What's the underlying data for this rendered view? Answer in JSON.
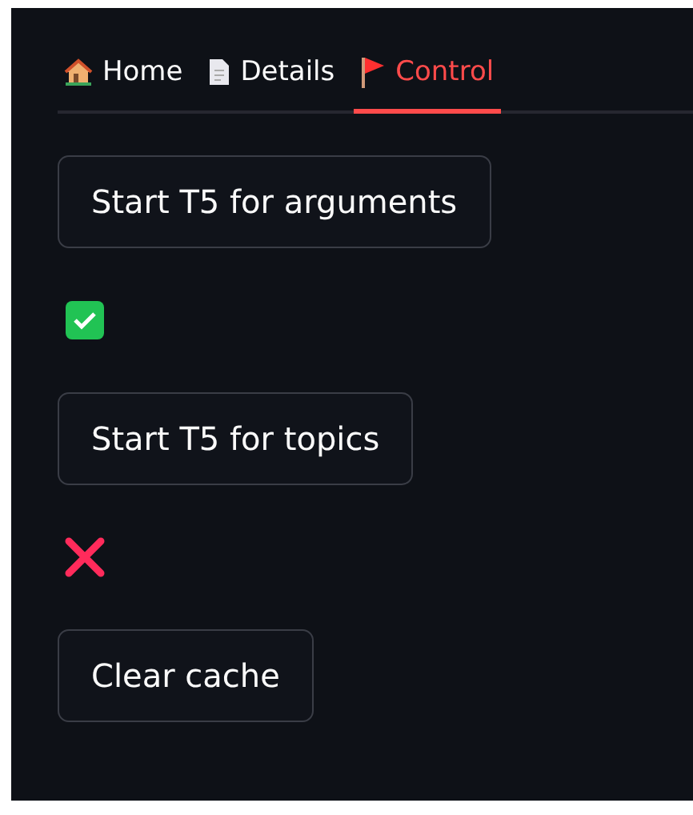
{
  "tabs": [
    {
      "label": "Home",
      "kind": "house",
      "selected": false
    },
    {
      "label": "Details",
      "kind": "page",
      "selected": false
    },
    {
      "label": "Control",
      "kind": "flag",
      "selected": true
    }
  ],
  "items": [
    {
      "kind": "button",
      "label": "Start T5 for arguments"
    },
    {
      "kind": "status",
      "ok": true
    },
    {
      "kind": "button",
      "label": "Start T5 for topics"
    },
    {
      "kind": "status",
      "ok": false
    },
    {
      "kind": "button",
      "label": "Clear cache"
    }
  ]
}
